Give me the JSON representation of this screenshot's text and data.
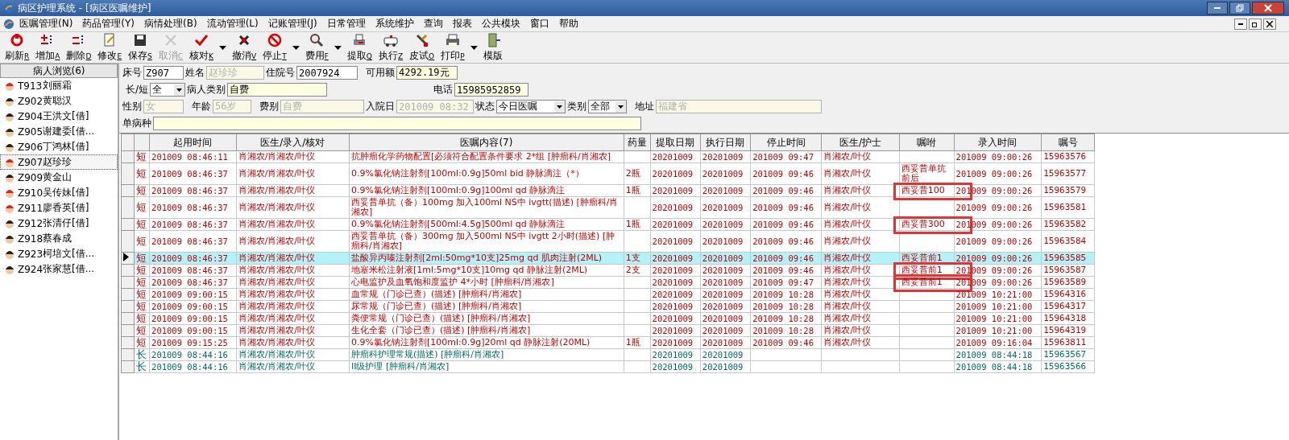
{
  "window": {
    "title": "病区护理系统 - [病区医嘱维护]"
  },
  "menu": [
    "医嘱管理(N)",
    "药品管理(Y)",
    "病情处理(B)",
    "流动管理(L)",
    "记账管理(J)",
    "日常管理",
    "系统维护",
    "查询",
    "报表",
    "公共模块",
    "窗口",
    "帮助"
  ],
  "toolbar": [
    {
      "label": "刷新",
      "key": "R",
      "disabled": false,
      "dropdown": false
    },
    {
      "label": "增加",
      "key": "A",
      "disabled": false,
      "dropdown": false
    },
    {
      "label": "删除",
      "key": "D",
      "disabled": false,
      "dropdown": false
    },
    {
      "label": "修改",
      "key": "E",
      "disabled": false,
      "dropdown": false
    },
    {
      "label": "保存",
      "key": "S",
      "disabled": false,
      "dropdown": false
    },
    {
      "label": "取消",
      "key": "C",
      "disabled": true,
      "dropdown": false
    },
    {
      "label": "核对",
      "key": "K",
      "disabled": false,
      "dropdown": true
    },
    {
      "label": "撤消",
      "key": "V",
      "disabled": false,
      "dropdown": false
    },
    {
      "label": "停止",
      "key": "T",
      "disabled": false,
      "dropdown": true
    },
    {
      "label": "费用",
      "key": "F",
      "disabled": false,
      "dropdown": true
    },
    {
      "label": "提取",
      "key": "Q",
      "disabled": false,
      "dropdown": false
    },
    {
      "label": "执行",
      "key": "Z",
      "disabled": false,
      "dropdown": false
    },
    {
      "label": "皮试",
      "key": "O",
      "disabled": false,
      "dropdown": false
    },
    {
      "label": "打印",
      "key": "P",
      "disabled": false,
      "dropdown": true
    },
    {
      "label": "模版",
      "disabled": false,
      "dropdown": false
    }
  ],
  "patients": {
    "title": "病人浏览(6)",
    "items": [
      {
        "bed": "T913",
        "name": "刘丽霜",
        "female": true,
        "selected": false
      },
      {
        "bed": "Z902",
        "name": "黄聪汉",
        "female": false,
        "selected": false
      },
      {
        "bed": "Z904",
        "name": "王洪文[借]",
        "female": false,
        "selected": false
      },
      {
        "bed": "Z905",
        "name": "谢建委[借...",
        "female": false,
        "selected": false
      },
      {
        "bed": "Z906",
        "name": "丁鸿林[借]",
        "female": false,
        "selected": false
      },
      {
        "bed": "Z907",
        "name": "赵珍珍",
        "female": true,
        "selected": true
      },
      {
        "bed": "Z909",
        "name": "黄金山",
        "female": false,
        "selected": false
      },
      {
        "bed": "Z910",
        "name": "吴传妹[借]",
        "female": true,
        "selected": false
      },
      {
        "bed": "Z911",
        "name": "廖香英[借]",
        "female": true,
        "selected": false
      },
      {
        "bed": "Z912",
        "name": "张清仔[借]",
        "female": false,
        "selected": false
      },
      {
        "bed": "Z918",
        "name": "蔡春成",
        "female": false,
        "selected": false
      },
      {
        "bed": "Z923",
        "name": "柯培文[借...",
        "female": false,
        "selected": false
      },
      {
        "bed": "Z924",
        "name": "张家慧[借...",
        "female": false,
        "selected": false
      }
    ]
  },
  "form": {
    "bed": {
      "label": "床号",
      "value": "Z907"
    },
    "name": {
      "label": "姓名",
      "value": "赵珍珍",
      "disabled": true
    },
    "admission_no": {
      "label": "住院号",
      "value": "2007924"
    },
    "balance": {
      "label": "可用额",
      "value": "4292.19元"
    },
    "term": {
      "label": "长/短",
      "value": "全"
    },
    "patient_type": {
      "label": "病人类别",
      "value": "自费"
    },
    "phone": {
      "label": "电话",
      "value": "15985952859"
    },
    "sex": {
      "label": "性别",
      "value": "女",
      "disabled": true
    },
    "age": {
      "label": "年龄",
      "value": "56岁",
      "disabled": true
    },
    "fee_type": {
      "label": "费别",
      "value": "自费",
      "disabled": true
    },
    "admit_date": {
      "label": "入院日",
      "value": "201009 08:32",
      "disabled": true
    },
    "status": {
      "label": "状态",
      "value": "今日医嘱"
    },
    "category": {
      "label": "类别",
      "value": "全部"
    },
    "address": {
      "label": "地址",
      "value": "福建省",
      "disabled": true
    },
    "disease": {
      "label": "单病种"
    }
  },
  "table": {
    "columns": [
      "起用时间",
      "医生/录入/核对",
      "医嘱内容(7)",
      "药量",
      "提取日期",
      "执行日期",
      "停止时间",
      "医生/护士",
      "嘱咐",
      "录入时间",
      "嘱号"
    ],
    "rows": [
      {
        "kind": "short",
        "type": "短",
        "start": "201009 08:46:11",
        "doctor": "肖湘农/肖湘农/叶仪",
        "content": "抗肿瘤化学药物配置[必须符合配置条件要求  2*组 [肿瘤科/肖湘农]",
        "dose": "",
        "fetch": "20201009",
        "exec": "20201009",
        "stop": "201009 09:47",
        "nurse": "肖湘农/叶仪",
        "note": "",
        "entry": "201009 09:00:26",
        "id": "15963576",
        "selected": false,
        "marked": false
      },
      {
        "kind": "short",
        "type": "短",
        "start": "201009 08:46:37",
        "doctor": "肖湘农/肖湘农/叶仪",
        "content": "0.9%氯化钠注射剂[100ml:0.9g]50ml bid 静脉滴注（*）",
        "dose": "2瓶",
        "fetch": "20201009",
        "exec": "20201009",
        "stop": "201009 09:46",
        "nurse": "肖湘农/叶仪",
        "note": "西妥昔单抗前后",
        "entry": "201009 09:00:26",
        "id": "15963577",
        "selected": false,
        "marked": false
      },
      {
        "kind": "short",
        "type": "短",
        "start": "201009 08:46:37",
        "doctor": "肖湘农/肖湘农/叶仪",
        "content": "0.9%氯化钠注射剂[100ml:0.9g]100ml qd 静脉滴注",
        "dose": "1瓶",
        "fetch": "20201009",
        "exec": "20201009",
        "stop": "201009 09:46",
        "nurse": "肖湘农/叶仪",
        "note": "西妥昔100",
        "entry": "201009 09:00:26",
        "id": "15963579",
        "selected": false,
        "marked": true
      },
      {
        "kind": "short",
        "type": "短",
        "start": "201009 08:46:37",
        "doctor": "肖湘农/肖湘农/叶仪",
        "content": "西妥昔单抗（备）100mg 加入100ml NS中 ivgtt(描述)  [肿瘤科/肖湘农]",
        "dose": "",
        "fetch": "20201009",
        "exec": "20201009",
        "stop": "201009 09:46",
        "nurse": "肖湘农/叶仪",
        "note": "",
        "entry": "201009 09:00:26",
        "id": "15963581",
        "selected": false,
        "marked": false
      },
      {
        "kind": "short",
        "type": "短",
        "start": "201009 08:46:37",
        "doctor": "肖湘农/肖湘农/叶仪",
        "content": "0.9%氯化钠注射剂[500ml:4.5g]500ml qd 静脉滴注",
        "dose": "1瓶",
        "fetch": "20201009",
        "exec": "20201009",
        "stop": "201009 09:46",
        "nurse": "肖湘农/叶仪",
        "note": "西妥昔300",
        "entry": "201009 09:00:26",
        "id": "15963582",
        "selected": false,
        "marked": true
      },
      {
        "kind": "short",
        "type": "短",
        "start": "201009 08:46:37",
        "doctor": "肖湘农/肖湘农/叶仪",
        "content": "西妥昔单抗（备）300mg 加入500ml NS中 ivgtt 2小时(描述)  [肿瘤科/肖湘农]",
        "dose": "",
        "fetch": "20201009",
        "exec": "20201009",
        "stop": "201009 09:46",
        "nurse": "肖湘农/叶仪",
        "note": "",
        "entry": "201009 09:00:26",
        "id": "15963584",
        "selected": false,
        "marked": false
      },
      {
        "kind": "short",
        "type": "短",
        "start": "201009 08:46:37",
        "doctor": "肖湘农/肖湘农/叶仪",
        "content": "盐酸异丙嗪注射剂[2ml:50mg*10支]25mg qd 肌肉注射(2ML)",
        "dose": "1支",
        "fetch": "20201009",
        "exec": "20201009",
        "stop": "201009 09:46",
        "nurse": "肖湘农/叶仪",
        "note": "西妥昔前1",
        "entry": "201009 09:00:26",
        "id": "15963585",
        "selected": true,
        "marked": false
      },
      {
        "kind": "short",
        "type": "短",
        "start": "201009 08:46:37",
        "doctor": "肖湘农/肖湘农/叶仪",
        "content": "地塞米松注射液[1ml:5mg*10支]10mg qd 静脉注射(2ML)",
        "dose": "2支",
        "fetch": "20201009",
        "exec": "20201009",
        "stop": "201009 09:46",
        "nurse": "肖湘农/叶仪",
        "note": "西妥昔前1",
        "entry": "201009 09:00:26",
        "id": "15963587",
        "selected": false,
        "marked": true
      },
      {
        "kind": "short",
        "type": "短",
        "start": "201009 08:46:37",
        "doctor": "肖湘农/肖湘农/叶仪",
        "content": "心电监护及血氧饱和度监护  4*小时 [肿瘤科/肖湘农]",
        "dose": "",
        "fetch": "20201009",
        "exec": "20201009",
        "stop": "201009 09:47",
        "nurse": "肖湘农/叶仪",
        "note": "西妥昔前1",
        "entry": "201009 09:00:26",
        "id": "15963589",
        "selected": false,
        "marked": true
      },
      {
        "kind": "short",
        "type": "短",
        "start": "201009 09:00:15",
        "doctor": "肖湘农/肖湘农/叶仪",
        "content": "血常规（门诊已查）(描述)   [肿瘤科/肖湘农]",
        "dose": "",
        "fetch": "20201009",
        "exec": "20201009",
        "stop": "201009 10:28",
        "nurse": "肖湘农/叶仪",
        "note": "",
        "entry": "201009 10:21:00",
        "id": "15964316",
        "selected": false,
        "marked": false
      },
      {
        "kind": "short",
        "type": "短",
        "start": "201009 09:00:15",
        "doctor": "肖湘农/肖湘农/叶仪",
        "content": "尿常规（门诊已查）(描述)   [肿瘤科/肖湘农]",
        "dose": "",
        "fetch": "20201009",
        "exec": "20201009",
        "stop": "201009 10:28",
        "nurse": "肖湘农/叶仪",
        "note": "",
        "entry": "201009 10:21:00",
        "id": "15964317",
        "selected": false,
        "marked": false
      },
      {
        "kind": "short",
        "type": "短",
        "start": "201009 09:00:15",
        "doctor": "肖湘农/肖湘农/叶仪",
        "content": "粪便常规（门诊已查）(描述)   [肿瘤科/肖湘农]",
        "dose": "",
        "fetch": "20201009",
        "exec": "20201009",
        "stop": "201009 10:28",
        "nurse": "肖湘农/叶仪",
        "note": "",
        "entry": "201009 10:21:00",
        "id": "15964318",
        "selected": false,
        "marked": false
      },
      {
        "kind": "short",
        "type": "短",
        "start": "201009 09:00:15",
        "doctor": "肖湘农/肖湘农/叶仪",
        "content": "生化全套（门诊已查）(描述)   [肿瘤科/肖湘农]",
        "dose": "",
        "fetch": "20201009",
        "exec": "20201009",
        "stop": "201009 10:28",
        "nurse": "肖湘农/叶仪",
        "note": "",
        "entry": "201009 10:21:00",
        "id": "15964319",
        "selected": false,
        "marked": false
      },
      {
        "kind": "short",
        "type": "短",
        "start": "201009 09:15:25",
        "doctor": "肖湘农/肖湘农/叶仪",
        "content": "0.9%氯化钠注射剂[100ml:0.9g]20ml qd 静脉注射(20ML)",
        "dose": "1瓶",
        "fetch": "20201009",
        "exec": "20201009",
        "stop": "201009 09:46",
        "nurse": "肖湘农/叶仪",
        "note": "",
        "entry": "201009 09:16:04",
        "id": "15963811",
        "selected": false,
        "marked": false
      },
      {
        "kind": "long",
        "type": "长",
        "start": "201009 08:44:16",
        "doctor": "肖湘农/肖湘农/叶仪",
        "content": "肿瘤科护理常规(描述)   [肿瘤科/肖湘农]",
        "dose": "",
        "fetch": "20201009",
        "exec": "20201009",
        "stop": "",
        "nurse": "",
        "note": "",
        "entry": "201009 08:44:18",
        "id": "15963567",
        "selected": false,
        "marked": false
      },
      {
        "kind": "long",
        "type": "长",
        "start": "201009 08:44:16",
        "doctor": "肖湘农/肖湘农/叶仪",
        "content": "II级护理   [肿瘤科/肖湘农]",
        "dose": "",
        "fetch": "20201009",
        "exec": "20201009",
        "stop": "",
        "nurse": "",
        "note": "",
        "entry": "201009 08:44:18",
        "id": "15963566",
        "selected": false,
        "marked": false
      }
    ]
  }
}
